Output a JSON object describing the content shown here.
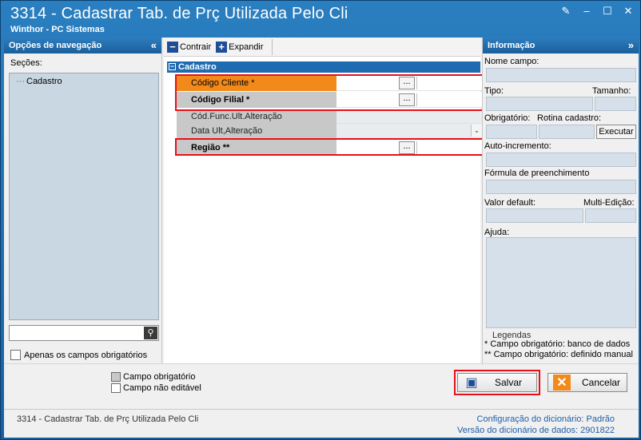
{
  "window": {
    "title": "3314 - Cadastrar Tab. de Prç Utilizada Pelo Cli",
    "subtitle": "Winthor - PC Sistemas"
  },
  "nav": {
    "header": "Opções de navegação",
    "sections_label": "Seções:",
    "tree_items": [
      "Cadastro"
    ],
    "only_required_label": "Apenas os campos obrigatórios"
  },
  "toolbar": {
    "collapse_label": "Contrair",
    "expand_label": "Expandir"
  },
  "grid": {
    "group_label": "Cadastro",
    "rows": [
      {
        "label": "Código Cliente *",
        "value": ""
      },
      {
        "label": "Código Filial *",
        "value": ""
      },
      {
        "label": "Cód.Func.Ult.Alteração",
        "value": ""
      },
      {
        "label": "Data Ult,Alteração",
        "value": ""
      },
      {
        "label": "Região **",
        "value": ""
      }
    ],
    "ellipsis": "..."
  },
  "info": {
    "header": "Informação",
    "field_name_label": "Nome campo:",
    "type_label": "Tipo:",
    "size_label": "Tamanho:",
    "required_label": "Obrigatório:",
    "routine_label": "Rotina cadastro:",
    "execute_label": "Executar",
    "autoinc_label": "Auto-incremento:",
    "formula_label": "Fórmula de preenchimento",
    "default_label": "Valor default:",
    "multi_label": "Multi-Edição:",
    "help_label": "Ajuda:",
    "legend_title": "Legendas",
    "legend_1": "* Campo obrigatório: banco de dados",
    "legend_2": "** Campo obrigatório: definido manual"
  },
  "bottom": {
    "legend_required": "Campo obrigatório",
    "legend_noedit": "Campo não editável",
    "save_label": "Salvar",
    "cancel_label": "Cancelar"
  },
  "status": {
    "left": "3314 - Cadastrar Tab. de Prç Utilizada Pelo Cli",
    "config_label": "Configuração do dicionário:",
    "config_value": "Padrão",
    "version_label": "Versão do dicionário de dados:",
    "version_value": "2901822"
  },
  "colors": {
    "title_blue": "#1f6bb1",
    "selected_orange": "#f28a1b",
    "highlight_red": "#e8101a"
  }
}
